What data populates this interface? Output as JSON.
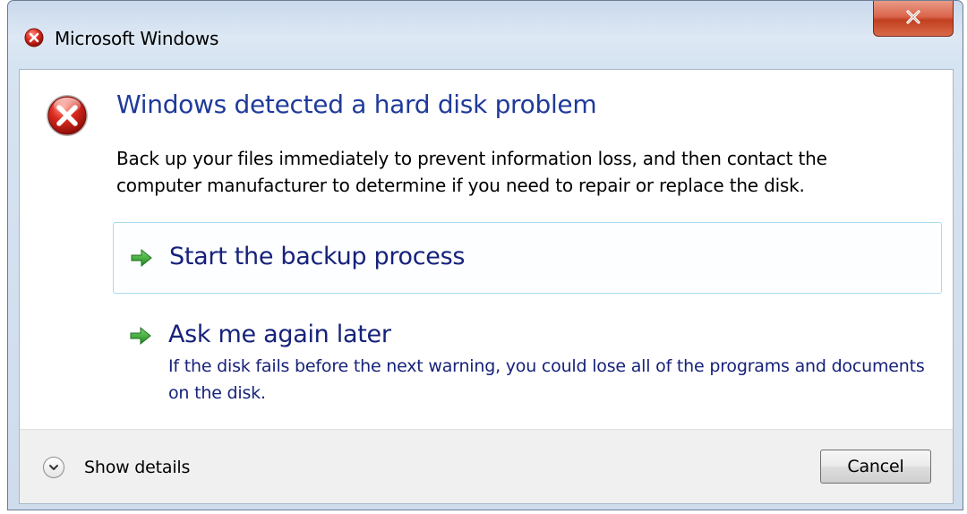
{
  "window": {
    "title": "Microsoft Windows",
    "title_icon": "error-icon",
    "close_icon": "close-icon"
  },
  "content": {
    "icon": "error-icon",
    "heading": "Windows detected a hard disk problem",
    "body": "Back up your files immediately to prevent information loss, and then contact the computer manufacturer to determine if you need to repair or replace the disk.",
    "commands": [
      {
        "label": "Start the backup process",
        "note": "",
        "icon": "green-arrow-icon"
      },
      {
        "label": "Ask me again later",
        "note": "If the disk fails before the next warning, you could lose all of the programs and documents on the disk.",
        "icon": "green-arrow-icon"
      }
    ]
  },
  "footer": {
    "details_label": "Show details",
    "details_icon": "chevron-down-icon",
    "cancel_label": "Cancel"
  },
  "colors": {
    "heading": "#1f3a9a",
    "command_text": "#16227a",
    "error_red": "#c8201a",
    "arrow_green": "#2fa12f"
  }
}
